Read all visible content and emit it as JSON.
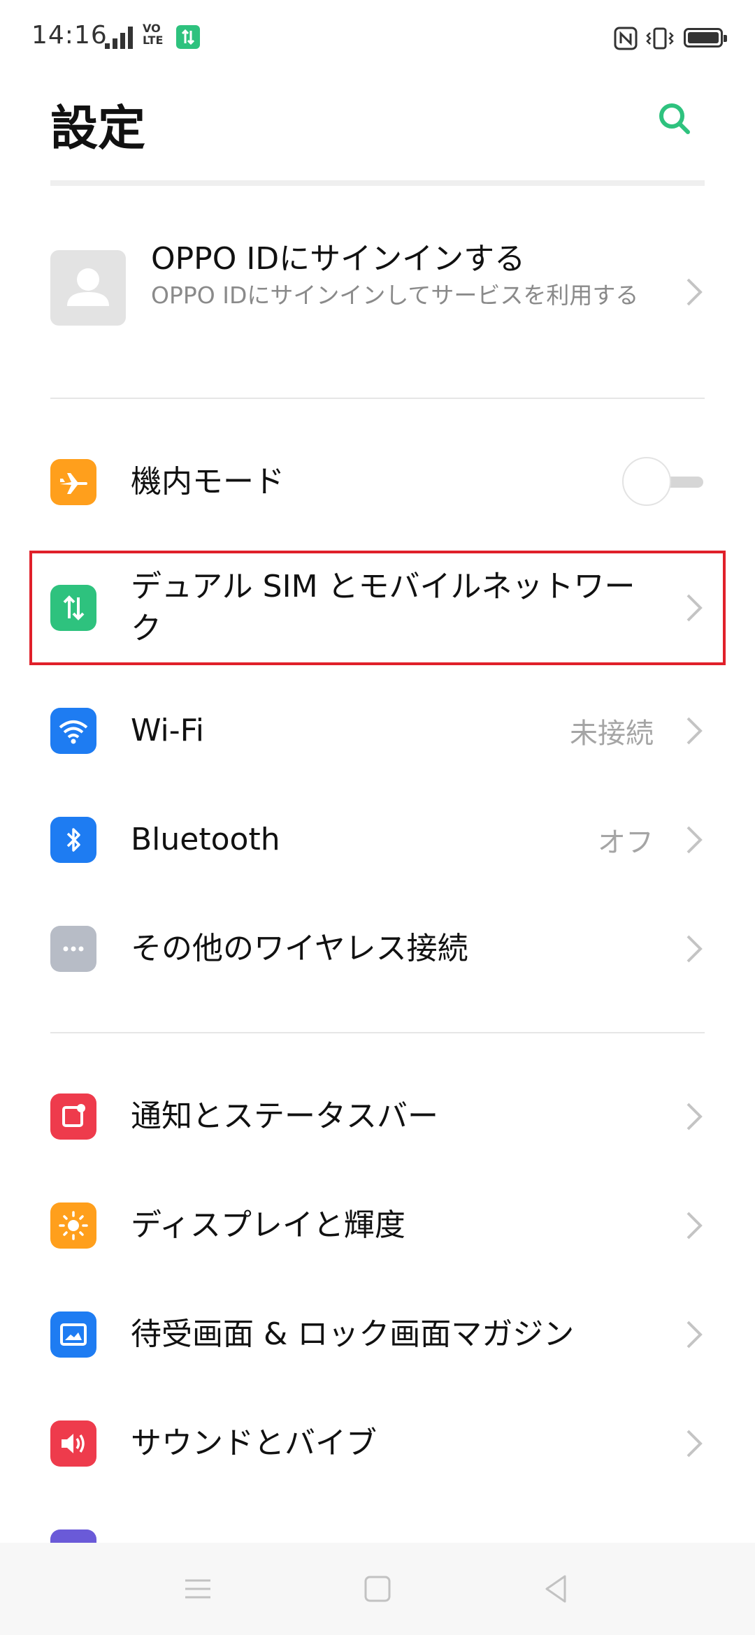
{
  "status_bar": {
    "time": "14:16",
    "volte_line1": "VO",
    "volte_line2": "LTE"
  },
  "header": {
    "title": "設定"
  },
  "account": {
    "title": "OPPO IDにサインインする",
    "subtitle": "OPPO IDにサインインしてサービスを利用する"
  },
  "rows": [
    {
      "label": "機内モード",
      "icon": "airplane-icon",
      "color": "#ff9f1c"
    },
    {
      "label": "デュアル SIM とモバイルネットワーク",
      "icon": "mobile-data-icon",
      "color": "#2ec27e"
    },
    {
      "label": "Wi-Fi",
      "value": "未接続",
      "icon": "wifi-icon",
      "color": "#1e7cf2"
    },
    {
      "label": "Bluetooth",
      "value": "オフ",
      "icon": "bluetooth-icon",
      "color": "#1e7cf2"
    },
    {
      "label": "その他のワイヤレス接続",
      "icon": "more-connections-icon",
      "color": "#b7bcc6"
    },
    {
      "label": "通知とステータスバー",
      "icon": "notification-icon",
      "color": "#ee3b4c"
    },
    {
      "label": "ディスプレイと輝度",
      "icon": "brightness-icon",
      "color": "#ff9f1c"
    },
    {
      "label": "待受画面 & ロック画面マガジン",
      "icon": "wallpaper-icon",
      "color": "#1e7cf2"
    },
    {
      "label": "サウンドとバイブ",
      "icon": "sound-icon",
      "color": "#ee3b4c"
    }
  ],
  "toggles": {
    "airplane_mode_on": false
  },
  "colors": {
    "accent": "#2ec27e",
    "highlight_border": "#e0202a"
  }
}
